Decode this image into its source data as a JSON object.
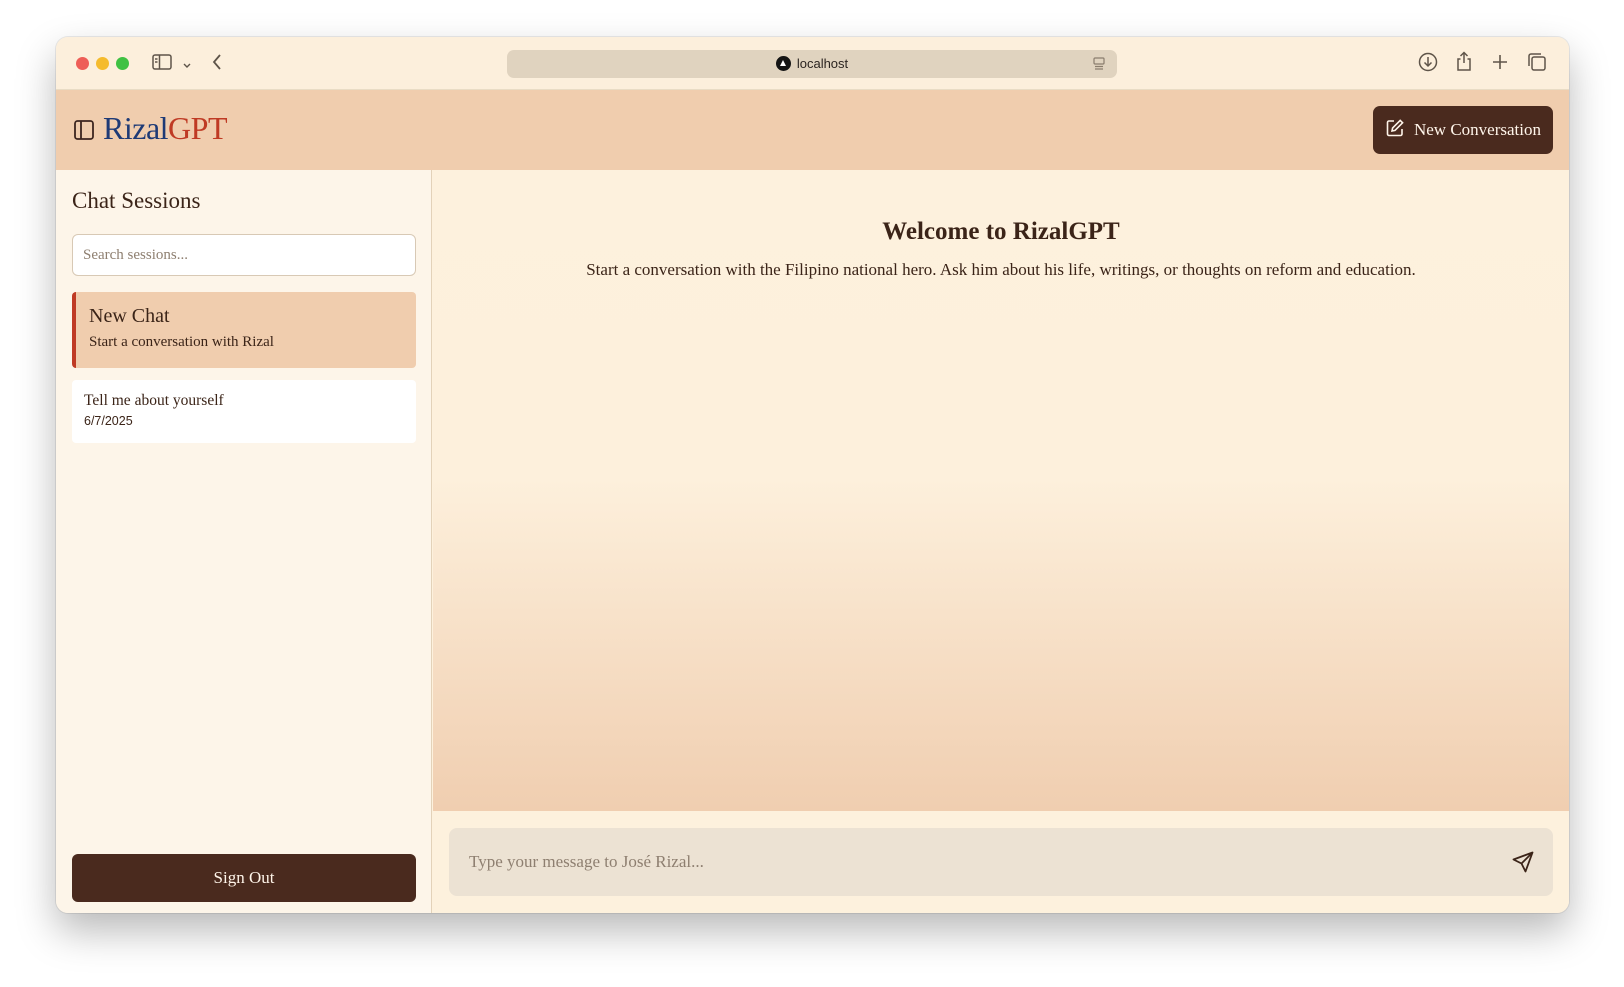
{
  "browser": {
    "url": "localhost"
  },
  "header": {
    "brand_part1": "Rizal",
    "brand_part2": "GPT",
    "new_conversation_label": "New Conversation"
  },
  "sidebar": {
    "title": "Chat Sessions",
    "search_placeholder": "Search sessions...",
    "sessions": [
      {
        "title": "New Chat",
        "subtitle": "Start a conversation with Rizal",
        "active": true
      },
      {
        "title": "Tell me about yourself",
        "date": "6/7/2025",
        "active": false
      }
    ],
    "sign_out_label": "Sign Out"
  },
  "main": {
    "welcome_title": "Welcome to RizalGPT",
    "welcome_subtitle": "Start a conversation with the Filipino national hero. Ask him about his life, writings, or thoughts on reform and education.",
    "message_placeholder": "Type your message to José Rizal..."
  },
  "colors": {
    "header_bg": "#f0cdae",
    "dark_brown": "#4a2a1e",
    "brand_blue": "#1e3a76",
    "brand_red": "#bf3a24"
  }
}
